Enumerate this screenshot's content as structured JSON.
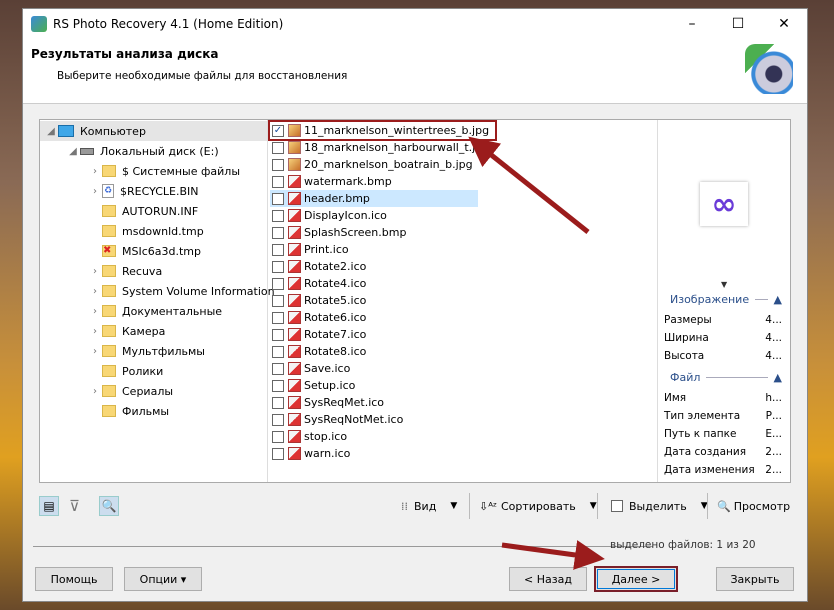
{
  "window": {
    "title": "RS Photo Recovery 4.1 (Home Edition)",
    "minimize": "–",
    "maximize": "☐",
    "close": "✕"
  },
  "header": {
    "title": "Результаты анализа диска",
    "subtitle": "Выберите необходимые файлы для восстановления"
  },
  "tree": [
    {
      "label": "Компьютер",
      "level": 0,
      "icon": "computer-icon",
      "chev": "◢"
    },
    {
      "label": "Локальный диск (E:)",
      "level": 1,
      "icon": "drive-icon",
      "chev": "◢"
    },
    {
      "label": "$ Системные файлы",
      "level": 2,
      "icon": "folder-icon",
      "chev": "›"
    },
    {
      "label": "$RECYCLE.BIN",
      "level": 2,
      "icon": "recycle-icon",
      "chev": "›"
    },
    {
      "label": "AUTORUN.INF",
      "level": 2,
      "icon": "folder-icon",
      "chev": ""
    },
    {
      "label": "msdownld.tmp",
      "level": 2,
      "icon": "folder-icon",
      "chev": ""
    },
    {
      "label": "MSIc6a3d.tmp",
      "level": 2,
      "icon": "deleted-folder-icon",
      "chev": ""
    },
    {
      "label": "Recuva",
      "level": 2,
      "icon": "folder-icon",
      "chev": "›"
    },
    {
      "label": "System Volume Information",
      "level": 2,
      "icon": "folder-icon",
      "chev": "›"
    },
    {
      "label": "Документальные",
      "level": 2,
      "icon": "folder-icon",
      "chev": "›"
    },
    {
      "label": "Камера",
      "level": 2,
      "icon": "folder-icon",
      "chev": "›"
    },
    {
      "label": "Мультфильмы",
      "level": 2,
      "icon": "folder-icon",
      "chev": "›"
    },
    {
      "label": "Ролики",
      "level": 2,
      "icon": "folder-icon",
      "chev": ""
    },
    {
      "label": "Сериалы",
      "level": 2,
      "icon": "folder-icon",
      "chev": "›"
    },
    {
      "label": "Фильмы",
      "level": 2,
      "icon": "folder-icon",
      "chev": ""
    }
  ],
  "files": [
    {
      "name": "11_marknelson_wintertrees_b.jpg",
      "checked": true,
      "type": "jpg"
    },
    {
      "name": "18_marknelson_harbourwall_t.jpg",
      "checked": false,
      "type": "jpg"
    },
    {
      "name": "20_marknelson_boatrain_b.jpg",
      "checked": false,
      "type": "jpg"
    },
    {
      "name": "watermark.bmp",
      "checked": false,
      "type": "img"
    },
    {
      "name": "header.bmp",
      "checked": false,
      "type": "img"
    },
    {
      "name": "DisplayIcon.ico",
      "checked": false,
      "type": "img"
    },
    {
      "name": "SplashScreen.bmp",
      "checked": false,
      "type": "img"
    },
    {
      "name": "Print.ico",
      "checked": false,
      "type": "img"
    },
    {
      "name": "Rotate2.ico",
      "checked": false,
      "type": "img"
    },
    {
      "name": "Rotate4.ico",
      "checked": false,
      "type": "img"
    },
    {
      "name": "Rotate5.ico",
      "checked": false,
      "type": "img"
    },
    {
      "name": "Rotate6.ico",
      "checked": false,
      "type": "img"
    },
    {
      "name": "Rotate7.ico",
      "checked": false,
      "type": "img"
    },
    {
      "name": "Rotate8.ico",
      "checked": false,
      "type": "img"
    },
    {
      "name": "Save.ico",
      "checked": false,
      "type": "img"
    },
    {
      "name": "Setup.ico",
      "checked": false,
      "type": "img"
    },
    {
      "name": "SysReqMet.ico",
      "checked": false,
      "type": "img"
    },
    {
      "name": "SysReqNotMet.ico",
      "checked": false,
      "type": "img"
    },
    {
      "name": "stop.ico",
      "checked": false,
      "type": "img"
    },
    {
      "name": "warn.ico",
      "checked": false,
      "type": "img"
    }
  ],
  "preview": {
    "image_section": "Изображение",
    "image_props": [
      {
        "k": "Размеры",
        "v": "4..."
      },
      {
        "k": "Ширина",
        "v": "4..."
      },
      {
        "k": "Высота",
        "v": "4..."
      }
    ],
    "file_section": "Файл",
    "file_props": [
      {
        "k": "Имя",
        "v": "h..."
      },
      {
        "k": "Тип элемента",
        "v": "Р..."
      },
      {
        "k": "Путь к папке",
        "v": "E..."
      },
      {
        "k": "Дата создания",
        "v": "2..."
      },
      {
        "k": "Дата изменения",
        "v": "2..."
      }
    ]
  },
  "toolbar": {
    "view": "Вид",
    "sort": "Сортировать",
    "select": "Выделить",
    "preview": "Просмотр"
  },
  "status": "выделено файлов: 1 из 20",
  "buttons": {
    "help": "Помощь",
    "options": "Опции ▾",
    "back": "< Назад",
    "next": "Далее >",
    "close": "Закрыть"
  },
  "colors": {
    "annotation": "#9b1c1c",
    "selection": "#cce8ff"
  }
}
